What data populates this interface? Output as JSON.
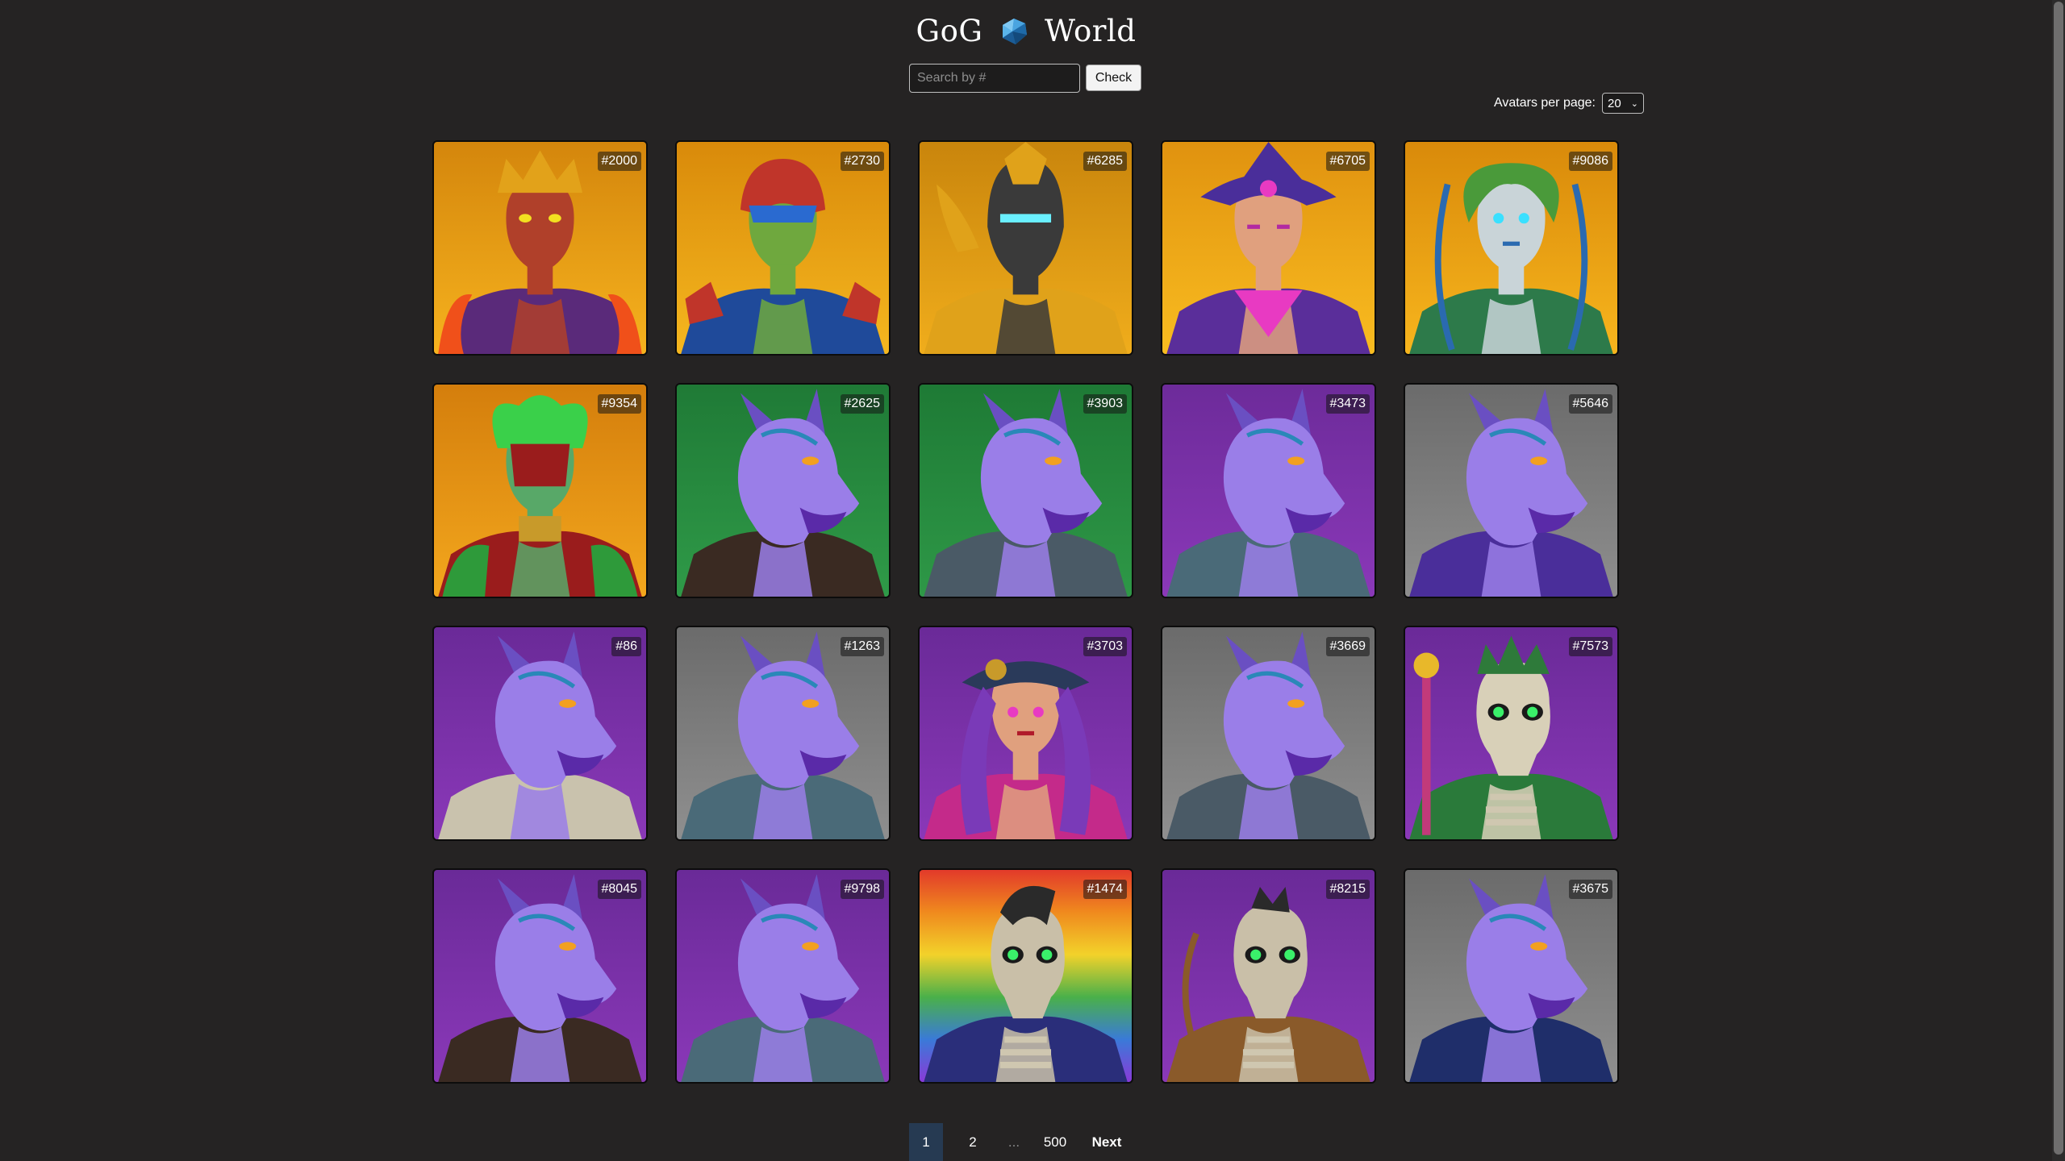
{
  "header": {
    "title_left": "GoG",
    "title_right": "World",
    "logo_icon": "diamond-gem-icon"
  },
  "search": {
    "placeholder": "Search by #",
    "value": "",
    "button_label": "Check"
  },
  "perpage": {
    "label": "Avatars per page:",
    "value": "20"
  },
  "avatars": [
    {
      "id": "#2000",
      "bg": [
        "#d4860c",
        "#f6b21e"
      ],
      "skin": "#b0402a",
      "head": "crown-demon",
      "accent": "#5a2a7a"
    },
    {
      "id": "#2730",
      "bg": [
        "#d98a0a",
        "#f5b71f"
      ],
      "skin": "#6fa83e",
      "head": "orc-helm",
      "accent": "#1f4a9a"
    },
    {
      "id": "#6285",
      "bg": [
        "#c9850c",
        "#f0ad1c"
      ],
      "skin": "#3a3a3a",
      "head": "knight",
      "accent": "#e0a21a"
    },
    {
      "id": "#6705",
      "bg": [
        "#e0920f",
        "#f9bc20"
      ],
      "skin": "#e0a07e",
      "head": "witch",
      "accent": "#5a2e9a"
    },
    {
      "id": "#9086",
      "bg": [
        "#d98a0a",
        "#f7b51d"
      ],
      "skin": "#c9d4d8",
      "head": "elf",
      "accent": "#2d7a4a"
    },
    {
      "id": "#9354",
      "bg": [
        "#d47e0c",
        "#f3a71d"
      ],
      "skin": "#58a868",
      "head": "goblin-mask",
      "accent": "#9a1c1c"
    },
    {
      "id": "#2625",
      "bg": [
        "#1f7a36",
        "#2f9a48"
      ],
      "skin": "#9a7ee8",
      "head": "dragon",
      "accent": "#3a2a22"
    },
    {
      "id": "#3903",
      "bg": [
        "#1e7a35",
        "#2e9847"
      ],
      "skin": "#9a7ee8",
      "head": "dragon",
      "accent": "#4a5a66"
    },
    {
      "id": "#3473",
      "bg": [
        "#6d2b9a",
        "#8a38b8"
      ],
      "skin": "#9a7ee8",
      "head": "dragon",
      "accent": "#4a6a78"
    },
    {
      "id": "#5646",
      "bg": [
        "#6b6b6b",
        "#8e8e8e"
      ],
      "skin": "#9a7ee8",
      "head": "dragon",
      "accent": "#4a2e9a"
    },
    {
      "id": "#86",
      "bg": [
        "#6a2a98",
        "#8a38b8"
      ],
      "skin": "#9a7ee8",
      "head": "dragon",
      "accent": "#c9c2ad"
    },
    {
      "id": "#1263",
      "bg": [
        "#6b6b6b",
        "#8f8f8f"
      ],
      "skin": "#9a7ee8",
      "head": "dragon",
      "accent": "#4a6a78"
    },
    {
      "id": "#3703",
      "bg": [
        "#6a2a98",
        "#8a38b8"
      ],
      "skin": "#e0a07e",
      "head": "pirate",
      "accent": "#c42a8a"
    },
    {
      "id": "#3669",
      "bg": [
        "#6b6b6b",
        "#8f8f8f"
      ],
      "skin": "#9a7ee8",
      "head": "dragon",
      "accent": "#4a5a66"
    },
    {
      "id": "#7573",
      "bg": [
        "#6a2a98",
        "#8a38b8"
      ],
      "skin": "#d8d0b8",
      "head": "skeleton-crown",
      "accent": "#2a7a3a"
    },
    {
      "id": "#8045",
      "bg": [
        "#6a2a98",
        "#8a38b8"
      ],
      "skin": "#9a7ee8",
      "head": "dragon",
      "accent": "#3a2a22"
    },
    {
      "id": "#9798",
      "bg": [
        "#6a2a98",
        "#8a38b8"
      ],
      "skin": "#9a7ee8",
      "head": "dragon",
      "accent": "#4a6a78"
    },
    {
      "id": "#1474",
      "bg": [
        "rainbow"
      ],
      "skin": "#c9bfa8",
      "head": "skeleton-punk",
      "accent": "#2a2e7a"
    },
    {
      "id": "#8215",
      "bg": [
        "#6a2a98",
        "#8a38b8"
      ],
      "skin": "#c9bfa8",
      "head": "skeleton-archer",
      "accent": "#8a5a2a"
    },
    {
      "id": "#3675",
      "bg": [
        "#6b6b6b",
        "#8f8f8f"
      ],
      "skin": "#9a7ee8",
      "head": "dragon",
      "accent": "#1f2e6a"
    }
  ],
  "pagination": {
    "current": "1",
    "second": "2",
    "ellipsis": "...",
    "last": "500",
    "next_label": "Next"
  }
}
